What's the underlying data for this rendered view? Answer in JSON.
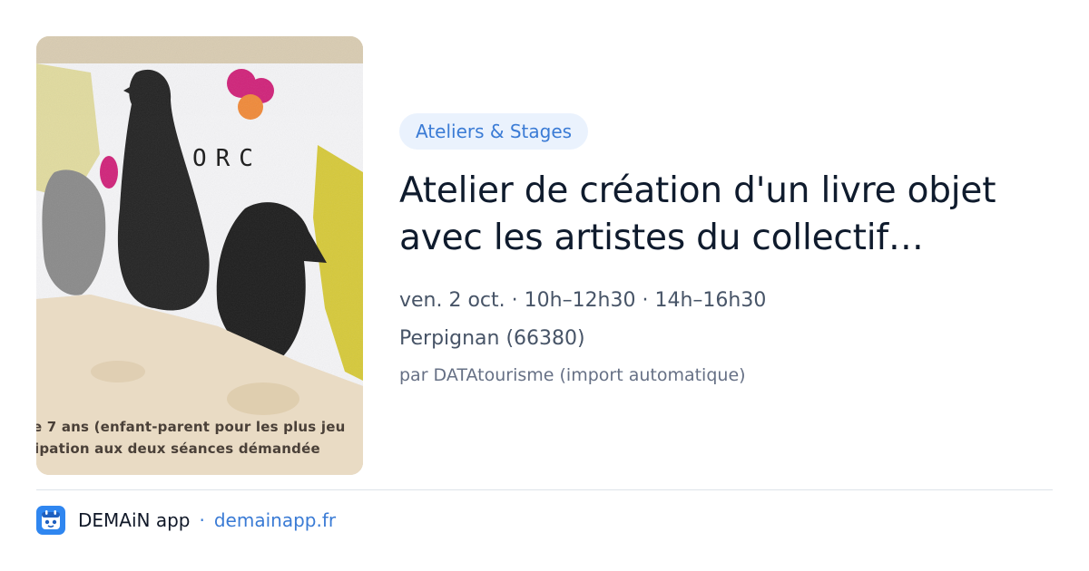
{
  "event": {
    "category": "Ateliers & Stages",
    "title": "Atelier de création d'un livre objet avec les artistes du collectif…",
    "schedule": "ven. 2 oct. · 10h–12h30 · 14h–16h30",
    "location": "Perpignan (66380)",
    "author": "par DATAtourisme (import automatique)"
  },
  "thumbnail": {
    "caption_line1": "e 7 ans (enfant-parent pour les plus jeu",
    "caption_line2": "ipation aux deux séances démandée",
    "printed_letters": "ORC",
    "colors": {
      "paper": "#e8dcc7",
      "ink": "#1e1e1e",
      "yellow": "#d6c93a",
      "magenta": "#d0237a",
      "orange": "#f08a3a"
    }
  },
  "footer": {
    "app_name": "DEMAiN app",
    "separator": "·",
    "site": "demainapp.fr",
    "app_icon": "demain-app-icon"
  },
  "colors": {
    "accent": "#3a7bd5",
    "badge_bg": "#eaf2fd",
    "title": "#0f1b2d",
    "meta": "#475467",
    "muted": "#667085",
    "divider": "#dde3ea"
  }
}
